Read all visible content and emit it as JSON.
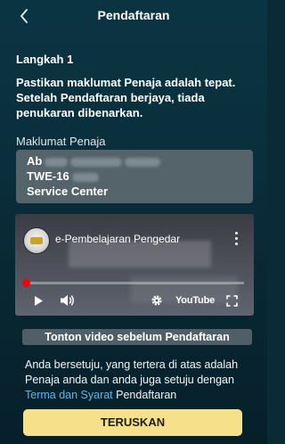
{
  "header": {
    "title": "Pendaftaran",
    "back_icon": "chevron-left-icon"
  },
  "step": {
    "label": "Langkah 1",
    "instruction": "Pastikan maklumat Penaja adalah tepat. Setelah Pendaftaran berjaya, tiada penukaran dibenarkan."
  },
  "sponsor": {
    "section_label": "Maklumat Penaja",
    "name_visible": "Ab",
    "id_visible": "TWE-16",
    "center": "Service Center"
  },
  "video": {
    "title": "e-Pembelajaran Pengedar",
    "progress_fraction": 0.02,
    "platform_label": "YouTube",
    "play_icon": "play-icon",
    "volume_icon": "volume-icon",
    "settings_icon": "gear-icon",
    "fullscreen_icon": "fullscreen-icon",
    "menu_icon": "more-vertical-icon"
  },
  "notice": {
    "watch_label": "Tonton video sebelum Pendaftaran"
  },
  "agreement": {
    "text_before": "Anda bersetuju, yang tertera di atas adalah Penaja anda dan anda juga setuju dengan ",
    "terms_link": "Terma dan Syarat",
    "text_after": " Pendaftaran"
  },
  "actions": {
    "continue_label": "TERUSKAN"
  },
  "colors": {
    "background": "#0a2f3c",
    "card": "#55636b",
    "link": "#59b9e4",
    "button": "#f7e08a",
    "progress": "#ff0000"
  }
}
